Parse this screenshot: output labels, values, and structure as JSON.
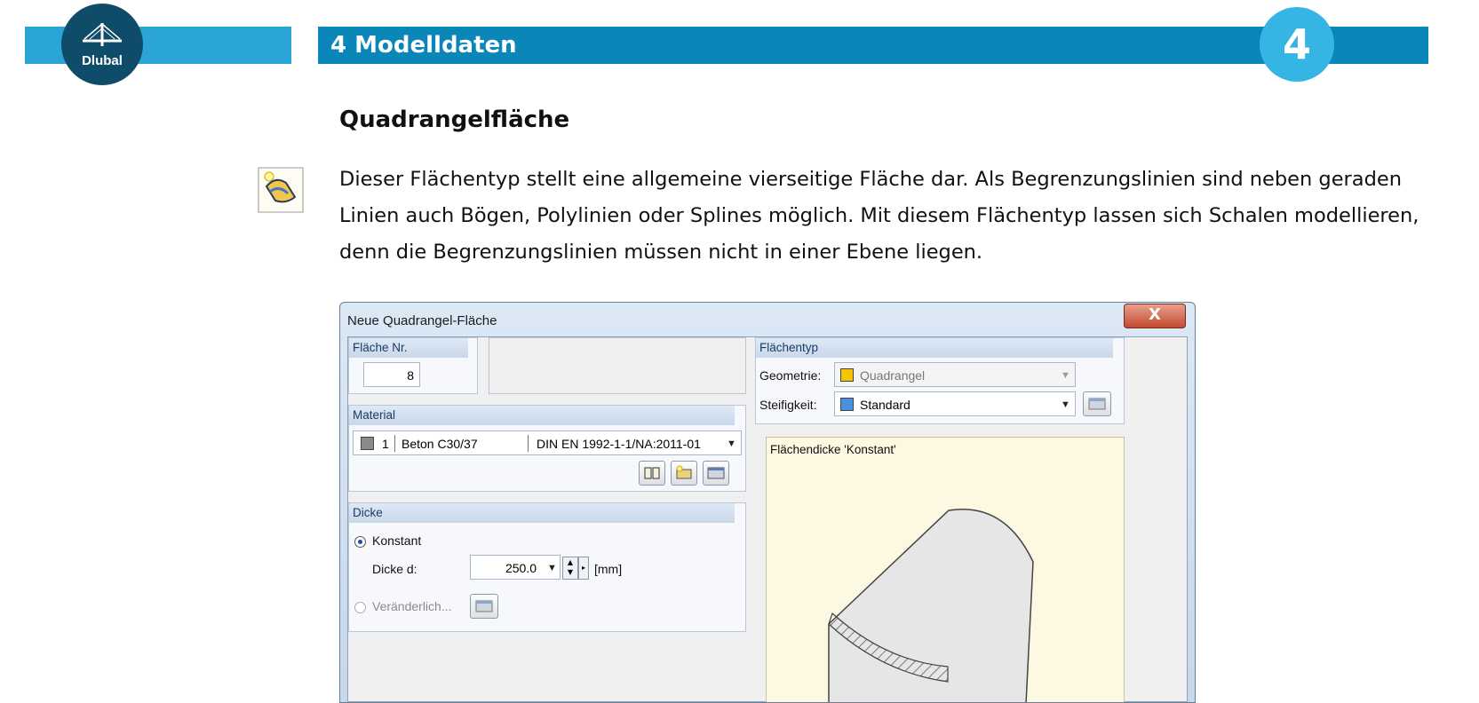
{
  "header": {
    "logo_text": "Dlubal",
    "chapter_title": "4  Modelldaten",
    "chapter_number": "4"
  },
  "section": {
    "title": "Quadrangelfläche",
    "text": "Dieser Flächentyp stellt eine allgemeine vierseitige Fläche dar. Als Begrenzungslinien sind neben geraden Linien auch Bögen, Polylinien oder Splines möglich. Mit diesem Flächentyp lassen sich Schalen modellieren, denn die Begrenzungslinien müssen nicht in einer Ebene liegen."
  },
  "dialog": {
    "title": "Neue Quadrangel-Fläche",
    "close_label": "X",
    "flaeche_nr": {
      "label": "Fläche Nr.",
      "value": "8"
    },
    "material": {
      "label": "Material",
      "number": "1",
      "name": "Beton C30/37",
      "norm": "DIN EN 1992-1-1/NA:2011-01"
    },
    "dicke": {
      "label": "Dicke",
      "konstant_label": "Konstant",
      "dicke_d_label": "Dicke d:",
      "dicke_d_value": "250.0",
      "unit": "[mm]",
      "veraenderlich_label": "Veränderlich..."
    },
    "flaechentyp": {
      "label": "Flächentyp",
      "geometrie_label": "Geometrie:",
      "geometrie_value": "Quadrangel",
      "steifigkeit_label": "Steifigkeit:",
      "steifigkeit_value": "Standard"
    },
    "preview_label": "Flächendicke 'Konstant'"
  },
  "colors": {
    "band_main": "#0a86b8",
    "band_left": "#2aa5d6",
    "logo": "#0f4c69",
    "swatch_geometrie": "#f5c400",
    "swatch_steifigkeit": "#4a8fe0",
    "swatch_material": "#8a8a8a"
  }
}
